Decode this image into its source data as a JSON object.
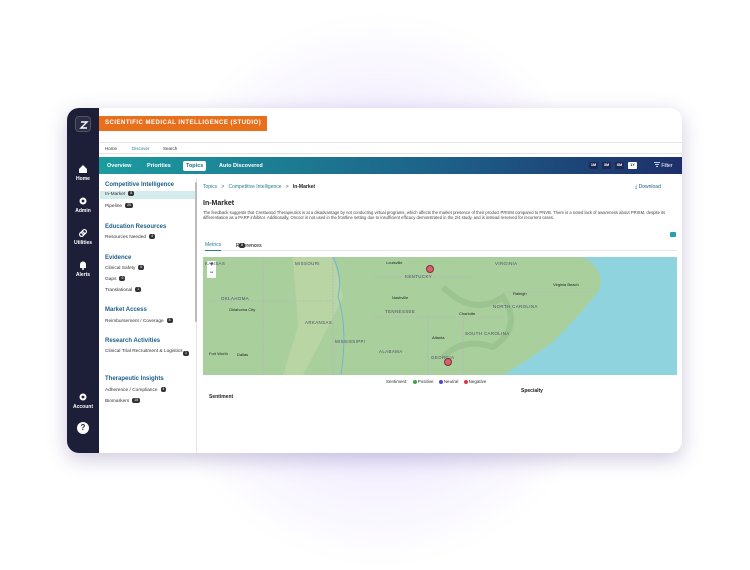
{
  "app": {
    "title": "SCIENTIFIC MEDICAL INTELLIGENCE (STUDIO)"
  },
  "rail": {
    "items": [
      {
        "label": "Home",
        "icon": "home-icon"
      },
      {
        "label": "Admin",
        "icon": "gear-icon"
      },
      {
        "label": "Utilities",
        "icon": "link-icon"
      },
      {
        "label": "Alerts",
        "icon": "bell-icon"
      },
      {
        "label": "Account",
        "icon": "gear-icon"
      }
    ],
    "help": "?"
  },
  "topnav": {
    "items": [
      "Home",
      "Discover",
      "Search"
    ],
    "active": "Discover"
  },
  "tabs": [
    "Overview",
    "Priorities",
    "Topics",
    "Auto Discovered"
  ],
  "active_tab": "Topics",
  "ranges": [
    "1M",
    "3M",
    "6M",
    "1Y"
  ],
  "active_range": "1Y",
  "filter_label": "Filter",
  "sidebar": {
    "sections": [
      {
        "title": "Competitive Intelligence",
        "items": [
          {
            "label": "In-Market",
            "count": "8"
          },
          {
            "label": "Pipeline",
            "count": "29"
          }
        ]
      },
      {
        "title": "Education Resources",
        "items": [
          {
            "label": "Resources Needed",
            "count": "4"
          }
        ]
      },
      {
        "title": "Evidence",
        "items": [
          {
            "label": "Clinical Safety",
            "count": "6"
          },
          {
            "label": "Gaps",
            "count": "6"
          },
          {
            "label": "Translational",
            "count": "1"
          }
        ]
      },
      {
        "title": "Market Access",
        "items": [
          {
            "label": "Reimbursement / Coverage",
            "count": "5"
          }
        ]
      },
      {
        "title": "Research Activities",
        "items": [
          {
            "label": "Clinical Trial Recruitment & Logistics",
            "count": "1"
          }
        ]
      },
      {
        "title": "Therapeutic Insights",
        "items": [
          {
            "label": "Adherence / Compliance",
            "count": "4"
          },
          {
            "label": "Biomarkers",
            "count": "15"
          }
        ]
      }
    ]
  },
  "breadcrumb": {
    "root": "Topics",
    "mid": "Competitive Intelligence",
    "current": "In-Market"
  },
  "download_label": "Download",
  "page_title": "In-Market",
  "summary": "The feedback suggests that Crestwood Therapeutics is at a disadvantage by not conducting virtual programs, which affects the market presence of their product PRISM compared to PNVB. There is a noted lack of awareness about PRISM, despite its differentiation as a PARP inhibitor. Additionally, Oncocr is not used in the frontline setting due to insufficient efficacy demonstrated in the 2/4 study, and is instead reserved for recurrent cases.",
  "subtabs": [
    {
      "label": "Metrics"
    },
    {
      "label": "References",
      "count": "8"
    }
  ],
  "map": {
    "states": [
      "MISSOURI",
      "KENTUCKY",
      "VIRGINIA",
      "NORTH CAROLINA",
      "SOUTH CAROLINA",
      "OKLAHOMA",
      "ARKANSAS",
      "MISSISSIPPI",
      "ALABAMA",
      "GEORGIA",
      "TENNESSEE",
      "KANSAS"
    ],
    "cities": [
      "Louisville",
      "Nashville",
      "Charlotte",
      "Atlanta",
      "Oklahoma City",
      "Dallas",
      "Fort Worth",
      "Virginia Beach",
      "Raleigh"
    ],
    "zoom_in": "+",
    "zoom_out": "−",
    "markers": [
      {
        "sentiment": "Negative"
      },
      {
        "sentiment": "Negative"
      }
    ]
  },
  "legend": {
    "title": "Sentiment:",
    "items": [
      {
        "label": "Positive",
        "color": "#3aa84a"
      },
      {
        "label": "Neutral",
        "color": "#4a4ac8"
      },
      {
        "label": "Negative",
        "color": "#d2394a"
      }
    ]
  },
  "labels": {
    "sentiment": "Sentiment",
    "specialty": "Specialty"
  },
  "colors": {
    "accent": "#e8701c",
    "teal": "#1c9c9f",
    "rail": "#1d1e37"
  }
}
